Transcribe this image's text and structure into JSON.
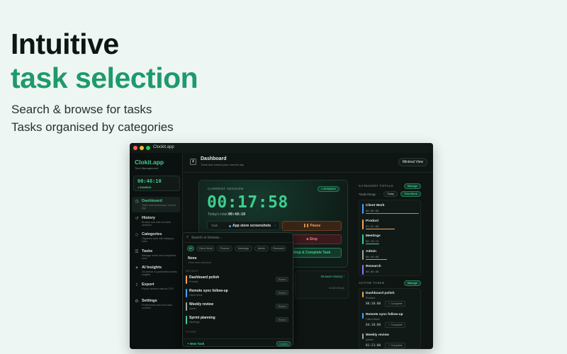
{
  "hero": {
    "title_line1": "Intuitive",
    "title_line2": "task selection",
    "subtitle_line1": "Search & browse for tasks",
    "subtitle_line2": "Tasks organised by categories",
    "accent_color": "#1e9a6c"
  },
  "window": {
    "title": "Clockit.app"
  },
  "sidebar": {
    "brand": "Clokit.app",
    "brand_sub": "Time Management",
    "mini_timer": "00:46:10",
    "mini_status": "RUNNING",
    "items": [
      {
        "label": "Dashboard",
        "desc": "Track and control your current day",
        "icon": "home-icon",
        "glyph": "◷",
        "active": true
      },
      {
        "label": "History",
        "desc": "Browse and edit recorded sessions",
        "icon": "history-icon",
        "glyph": "↺",
        "active": false
      },
      {
        "label": "Categories",
        "desc": "Organise work with category rules",
        "icon": "tag-icon",
        "glyph": "◇",
        "active": false
      },
      {
        "label": "Tasks",
        "desc": "Manage active and completed work",
        "icon": "list-icon",
        "glyph": "☰",
        "active": false
      },
      {
        "label": "AI Insights",
        "desc": "On-device AI-generated activity insights",
        "icon": "sparkle-icon",
        "glyph": "✦",
        "active": false
      },
      {
        "label": "Export",
        "desc": "Export session data as CSV",
        "icon": "export-icon",
        "glyph": "⇪",
        "active": false
      },
      {
        "label": "Settings",
        "desc": "Preferences and local data controls",
        "icon": "gear-icon",
        "glyph": "⚙",
        "active": false
      }
    ]
  },
  "header": {
    "title": "Dashboard",
    "subtitle": "Track and control your current day",
    "minimal_view_label": "Minimal View"
  },
  "session": {
    "label": "CURRENT SESSION",
    "status": "RUNNING",
    "timer": "00:17:58",
    "today_total_label": "Today's total",
    "today_total_value": "00:48:10",
    "task_label": "Task",
    "task_value": "App store screenshots",
    "pause_label": "Pause",
    "stop_label": "Stop",
    "complete_label": "Stop & Complete Task"
  },
  "recent": {
    "browse_label": "Browse History ›",
    "time": "10:40:03 pm"
  },
  "category_totals": {
    "heading": "CATEGORY TOTALS",
    "manage_label": "Manage",
    "range_label": "Totals Range",
    "range_options": [
      "Today",
      "This Week"
    ],
    "selected_range": "This Week",
    "items": [
      {
        "name": "Client Work",
        "time": "00:00:00",
        "color": "#4aa3ff",
        "share": 1.0
      },
      {
        "name": "Product",
        "time": "01:02:00",
        "color": "#f2a65a",
        "share": 0.55
      },
      {
        "name": "Meetings",
        "time": "00:18:13",
        "color": "#3ecf8e",
        "share": 0.25
      },
      {
        "name": "Admin",
        "time": "00:40:00",
        "color": "#9aa6a2",
        "share": 0.4
      },
      {
        "name": "Research",
        "time": "00:00:00",
        "color": "#8a7cf2",
        "share": 0.0
      }
    ]
  },
  "active_tasks": {
    "heading": "ACTIVE TASKS",
    "manage_label": "Manage",
    "complete_label": "✓ Complete",
    "items": [
      {
        "name": "Dashboard polish",
        "category": "Product",
        "time": "00:30:00",
        "color": "#f2a65a"
      },
      {
        "name": "Remote sync follow-up",
        "category": "Client Work",
        "time": "04:10:00",
        "color": "#4aa3ff"
      },
      {
        "name": "Weekly review",
        "category": "Admin",
        "time": "01:21:00",
        "color": "#9aa6a2"
      }
    ]
  },
  "dropdown": {
    "search_placeholder": "Search or browse...",
    "chips": [
      "All",
      "Client Work",
      "Product",
      "Meetings",
      "Admin",
      "Research"
    ],
    "selected_chip": "All",
    "none_label": "None",
    "none_desc": "Clear task selection",
    "recent_heading": "RECENT",
    "other_heading": "OTHER",
    "recent_badge": "Recent",
    "items": [
      {
        "name": "Dashboard polish",
        "category": "Product",
        "color": "#f2a65a"
      },
      {
        "name": "Remote sync follow-up",
        "category": "Client Work",
        "color": "#4aa3ff"
      },
      {
        "name": "Weekly review",
        "category": "Admin",
        "color": "#9aa6a2"
      },
      {
        "name": "Sprint planning",
        "category": "Meetings",
        "color": "#3ecf8e"
      }
    ],
    "new_task_label": "+ New Task",
    "count_label": "5 tasks"
  }
}
